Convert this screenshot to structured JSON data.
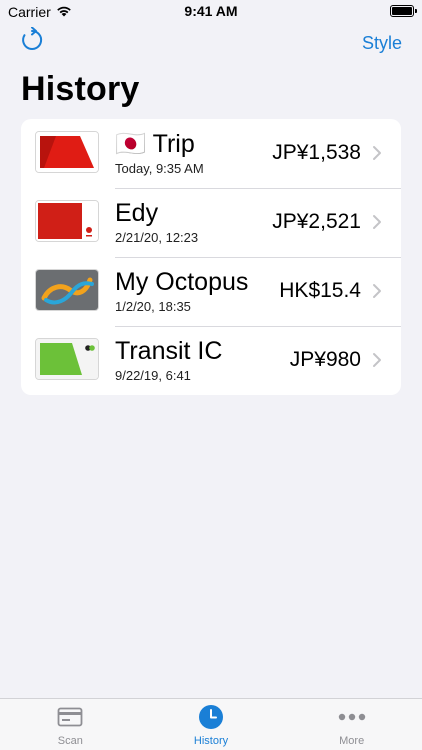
{
  "status_bar": {
    "carrier": "Carrier",
    "time": "9:41 AM"
  },
  "nav": {
    "style_label": "Style",
    "refresh_icon": "refresh-icon"
  },
  "title": "History",
  "cards": [
    {
      "flag": "🇯🇵",
      "title": "Trip",
      "subtitle": "Today, 9:35 AM",
      "amount": "JP¥1,538",
      "thumb": "red-card"
    },
    {
      "flag": "",
      "title": "Edy",
      "subtitle": "2/21/20, 12:23",
      "amount": "JP¥2,521",
      "thumb": "edy-card"
    },
    {
      "flag": "",
      "title": "My Octopus",
      "subtitle": "1/2/20, 18:35",
      "amount": "HK$15.4",
      "thumb": "octopus-card"
    },
    {
      "flag": "",
      "title": "Transit IC",
      "subtitle": "9/22/19, 6:41",
      "amount": "JP¥980",
      "thumb": "green-card"
    }
  ],
  "tabs": [
    {
      "label": "Scan",
      "icon": "card-icon",
      "active": false
    },
    {
      "label": "History",
      "icon": "clock-icon",
      "active": true
    },
    {
      "label": "More",
      "icon": "ellipsis-icon",
      "active": false
    }
  ],
  "colors": {
    "accent": "#1a7fd6",
    "background": "#f2f2f7"
  }
}
